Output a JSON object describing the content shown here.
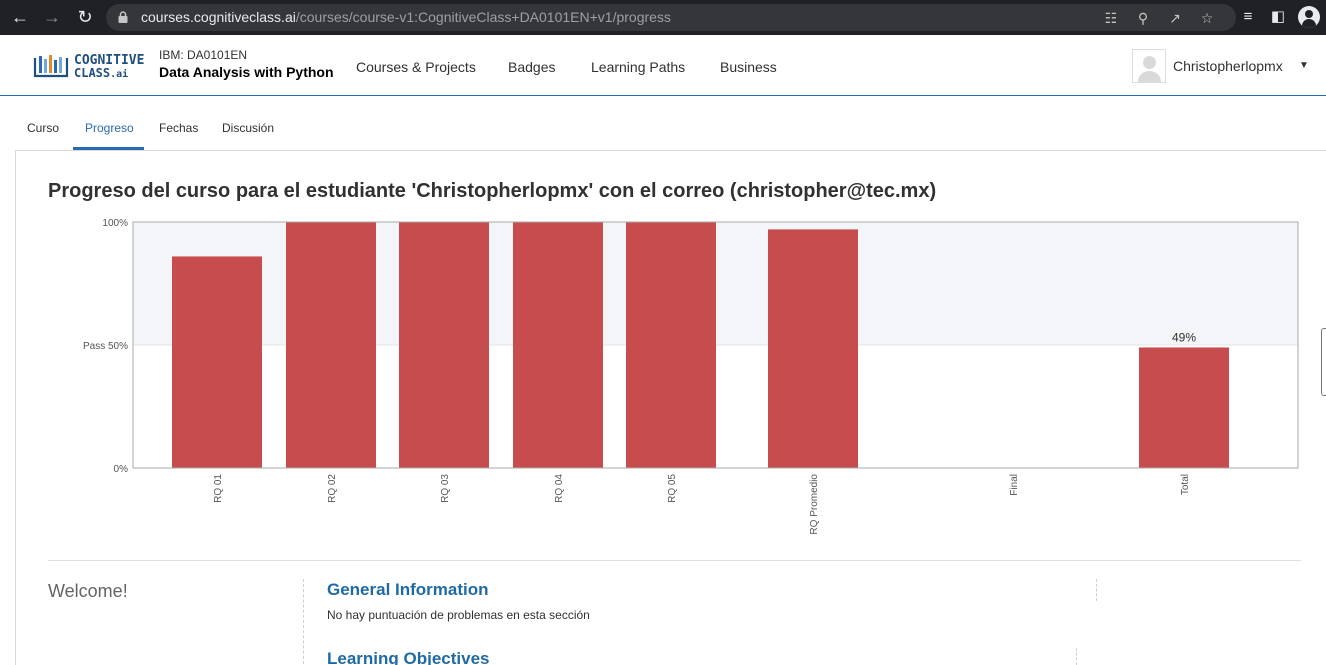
{
  "browser": {
    "url_host": "courses.cognitiveclass.ai",
    "url_path": "/courses/course-v1:CognitiveClass+DA0101EN+v1/progress",
    "icons": [
      "back-icon",
      "forward-icon",
      "reload-icon",
      "lock-icon",
      "translate-icon",
      "zoom-icon",
      "share-icon",
      "bookmark-star-icon",
      "reading-list-icon",
      "side-panel-icon",
      "profile-icon"
    ]
  },
  "header": {
    "logo_line1": "COGNITIVE",
    "logo_line2": "CLASS",
    "logo_suffix": ".ai",
    "course_org": "IBM: DA0101EN",
    "course_title": "Data Analysis with Python",
    "nav": [
      "Courses & Projects",
      "Badges",
      "Learning Paths",
      "Business"
    ],
    "username": "Christopherlopmx"
  },
  "tabs": [
    "Curso",
    "Progreso",
    "Fechas",
    "Discusión"
  ],
  "active_tab": "Progreso",
  "progress": {
    "heading": "Progreso del curso para el estudiante 'Christopherlopmx' con el correo (christopher@tec.mx)"
  },
  "chart_data": {
    "type": "bar",
    "categories": [
      "RQ 01",
      "RQ 02",
      "RQ 03",
      "RQ 04",
      "RQ 05",
      "RQ Promedio",
      "Final",
      "Total"
    ],
    "values": [
      86,
      100,
      100,
      100,
      100,
      97,
      0,
      49
    ],
    "ylim": [
      0,
      100
    ],
    "y_ticks": [
      {
        "value": 0,
        "label": "0%"
      },
      {
        "value": 50,
        "label": "Pass 50%"
      },
      {
        "value": 100,
        "label": "100%"
      }
    ],
    "pass_threshold": 50,
    "data_labels": [
      {
        "category": "Total",
        "label": "49%"
      }
    ],
    "bar_color": "#c64c4d",
    "band_color": "#f4f5f8"
  },
  "chapter": {
    "name": "Welcome!",
    "sections": [
      {
        "title": "General Information",
        "note": "No hay puntuación de problemas en esta sección"
      },
      {
        "title": "Learning Objectives"
      }
    ]
  }
}
